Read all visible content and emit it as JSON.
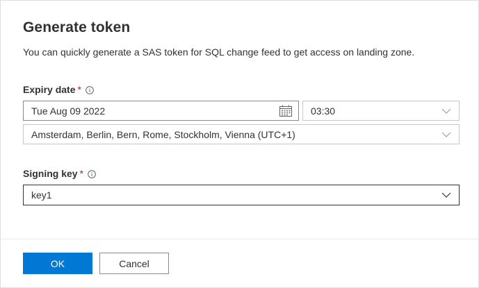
{
  "dialog": {
    "title": "Generate token",
    "description": "You can quickly generate a SAS token for SQL change feed to get access on landing zone."
  },
  "expiry": {
    "label": "Expiry date",
    "required_marker": "*",
    "date_value": "Tue Aug 09 2022",
    "time_value": "03:30",
    "timezone_value": "Amsterdam, Berlin, Bern, Rome, Stockholm, Vienna (UTC+1)"
  },
  "signing_key": {
    "label": "Signing key",
    "required_marker": "*",
    "value": "key1"
  },
  "footer": {
    "ok_label": "OK",
    "cancel_label": "Cancel"
  },
  "colors": {
    "primary": "#0078d4",
    "required": "#a4262c",
    "text": "#323130",
    "border": "#8a8886"
  },
  "icons": [
    "info-icon",
    "calendar-icon",
    "chevron-down-icon"
  ]
}
